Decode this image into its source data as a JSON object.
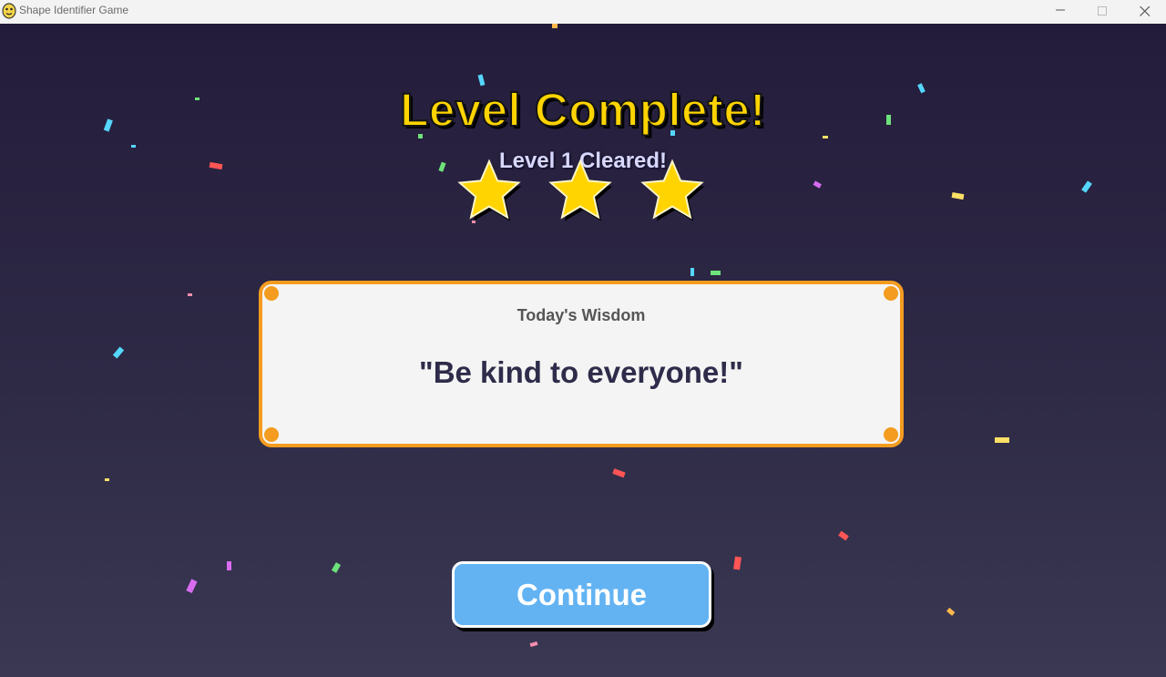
{
  "window": {
    "title": "Shape Identifier Game",
    "app_icon": "python-icon",
    "controls": [
      "minimize-icon",
      "maximize-icon",
      "close-icon"
    ]
  },
  "header": {
    "title": "Level Complete!",
    "subtitle": "Level 1 Cleared!"
  },
  "stars": {
    "earned": 3,
    "total": 3
  },
  "wisdom": {
    "title": "Today's Wisdom",
    "quote": "\"Be kind to everyone!\""
  },
  "continue_button": {
    "label": "Continue"
  },
  "colors": {
    "title": "#ffd400",
    "star": "#ffd400",
    "card_border": "#f39c1f",
    "button": "#63b3f3",
    "confetti": [
      "#ff5555",
      "#55d6ff",
      "#ffe066",
      "#6ee27a",
      "#d86bf0",
      "#ff8fb1",
      "#ffffff"
    ]
  }
}
